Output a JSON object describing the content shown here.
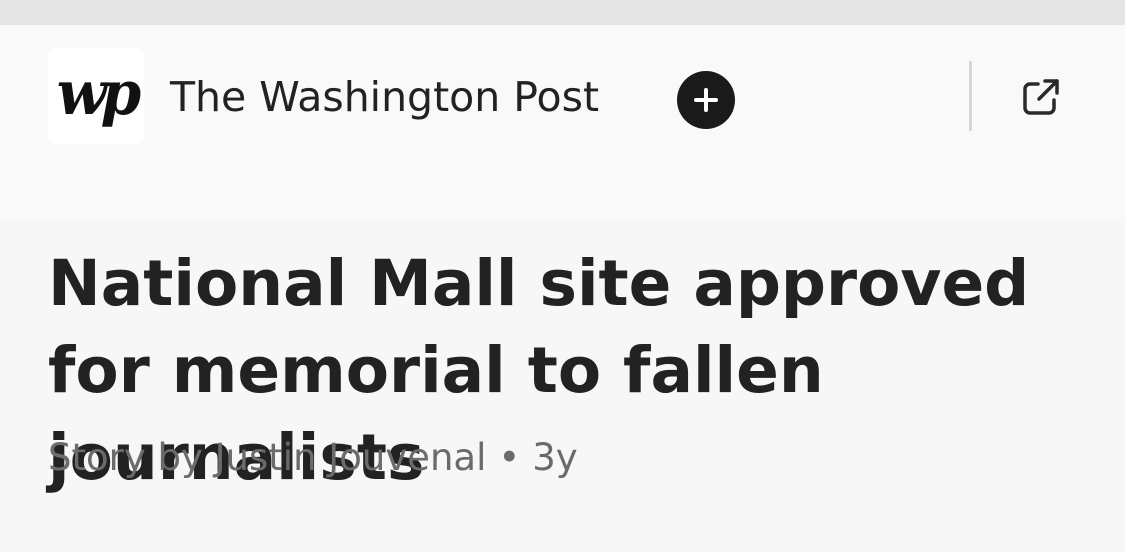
{
  "publisher": {
    "logo_text": "wp",
    "name": "The Washington Post"
  },
  "actions": {
    "follow_icon": "plus-circle-icon",
    "open_icon": "external-link-icon"
  },
  "article": {
    "headline": "National Mall site approved for memorial to fallen journalists",
    "byline": "Story by Justin Jouvenal",
    "separator": "•",
    "age": "3y"
  },
  "colors": {
    "background": "#f7f7f7",
    "header_background": "#f9f9f9",
    "top_strip": "#e5e5e5",
    "follow_button": "#1a1a1a",
    "byline_text": "#6b6b6b"
  }
}
